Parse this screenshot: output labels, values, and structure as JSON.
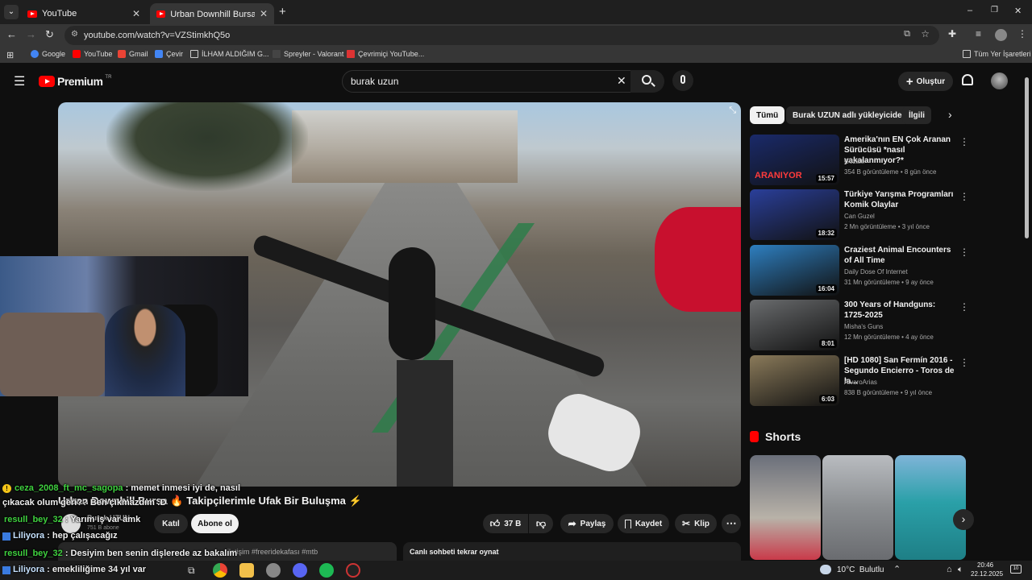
{
  "browser": {
    "tabs": [
      {
        "label": "YouTube",
        "active": false
      },
      {
        "label": "Urban Downhill Bursa 🔥 Takipç",
        "active": true
      }
    ],
    "new_tab": "+",
    "window_controls": {
      "minimize": "–",
      "maximize": "❐",
      "close": "✕"
    },
    "url": "youtube.com/watch?v=VZStimkhQ5o",
    "bookmarks": [
      "Google",
      "YouTube",
      "Gmail",
      "Çevir",
      "İLHAM ALDIĞIM G...",
      "Spreyler - Valorant",
      "Çevrimiçi YouTube..."
    ],
    "all_bookmarks": "Tüm Yer İşaretleri"
  },
  "youtube": {
    "logo_text": "Premium",
    "logo_sup": "TR",
    "search_value": "burak uzun",
    "create_label": "Oluştur",
    "chips": [
      "Tümü",
      "Burak UZUN adlı yükleyiciden",
      "İlgili"
    ],
    "recommendations": [
      {
        "title": "Amerika'nın EN Çok Aranan Sürücüsü *nasıl yakalanmıyor?*",
        "channel": "Gözaltı",
        "meta": "354 B görüntüleme • 8 gün önce",
        "duration": "15:57",
        "overlay": "ARANIYOR",
        "color": "#1a2a6a"
      },
      {
        "title": "Türkiye Yarışma Programları Komik Olaylar",
        "channel": "Can Guzel",
        "meta": "2 Mn görüntüleme • 3 yıl önce",
        "duration": "18:32",
        "color": "#2a3f9a"
      },
      {
        "title": "Craziest Animal Encounters of All Time",
        "channel": "Daily Dose Of Internet",
        "meta": "31 Mn görüntüleme • 9 ay önce",
        "duration": "16:04",
        "color": "#2e7fc0"
      },
      {
        "title": "300 Years of Handguns: 1725-2025",
        "channel": "Misha's Guns",
        "meta": "12 Mn görüntüleme • 4 ay önce",
        "duration": "8:01",
        "color": "#6a6c6e"
      },
      {
        "title": "[HD 1080] San Fermín 2016 - Segundo Encierro - Toros de la...",
        "channel": "ÁlvaroArias",
        "meta": "838 B görüntüleme • 9 yıl önce",
        "duration": "6:03",
        "color": "#8a7a5a"
      }
    ],
    "shorts_label": "Shorts",
    "video": {
      "title": "Urban Downhill Bursa 🔥 Takipçilerimle Ufak Bir Buluşma ⚡",
      "channel": "Burak UZUN",
      "subs": "751 B abone",
      "join": "Katıl",
      "subscribe": "Abone ol",
      "likes": "37 B",
      "share": "Paylaş",
      "save": "Kaydet",
      "clip": "Klip",
      "desc_tags": "#freeridekafası #mtb",
      "desc_prefix": "iletişim",
      "replay_chat": "Canlı sohbeti tekrar oynat"
    },
    "chat": [
      {
        "user": "ceza_2008_ft_mc_sagopa",
        "text": " : memet inmesi iyi de, nasıl"
      },
      {
        "user": "",
        "text": "çıkacak olum geri?? Ben çıkmazdım :D"
      },
      {
        "user": "resull_bey_32",
        "text": " : Yarım iş var amk"
      },
      {
        "user": "Liliyora",
        "text": " : hep çalışacağız"
      },
      {
        "user": "resull_bey_32",
        "text": " : Desiyim ben senin dişlerede az bakalım"
      },
      {
        "user": "Liliyora",
        "text": " : emekliliğime 34 yıl var"
      }
    ]
  },
  "taskbar": {
    "weather": "10°C  Bulutlu",
    "time": "20:46",
    "date": "22.12.2025",
    "notif": "10"
  }
}
